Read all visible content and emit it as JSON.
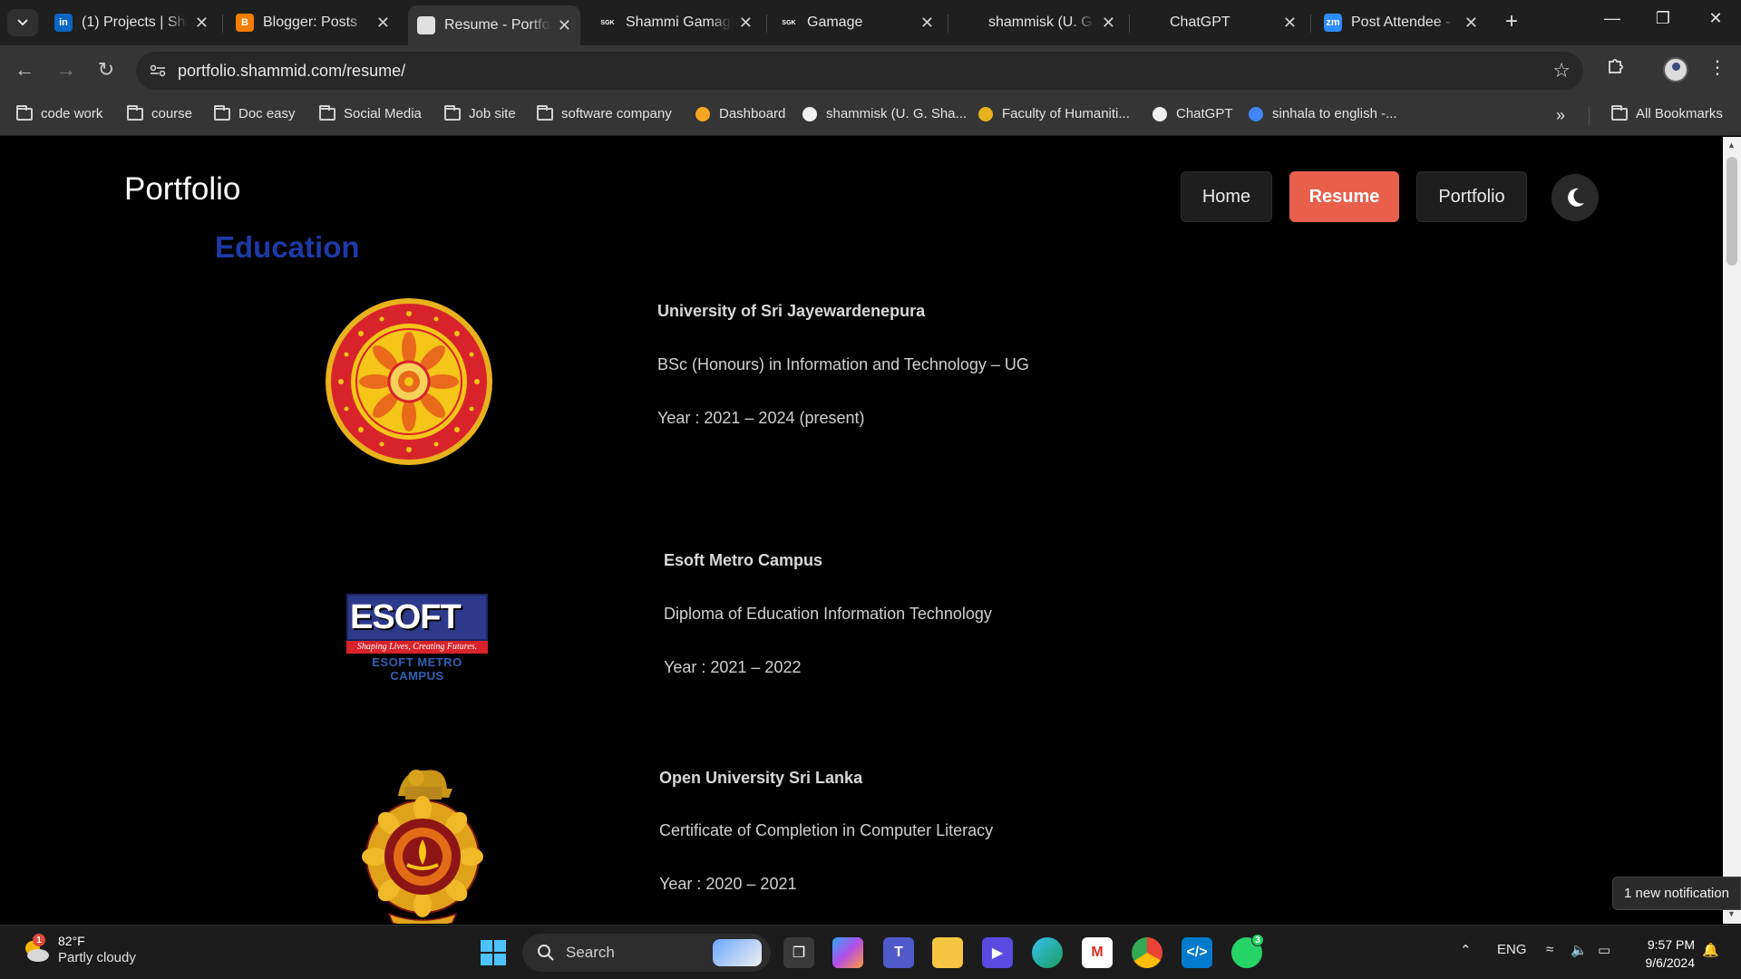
{
  "tabs": [
    {
      "title": "(1) Projects | Sha",
      "icon": "linkedin-icon",
      "color": "#0a66c2",
      "glyph": "in"
    },
    {
      "title": "Blogger: Posts",
      "icon": "blogger-icon",
      "color": "#f57d00",
      "glyph": "B"
    },
    {
      "title": "Resume - Portfol",
      "icon": "profile-favicon-icon",
      "color": "#e0e0e0",
      "glyph": "",
      "active": true
    },
    {
      "title": "Shammi Gamage",
      "icon": "sgk-favicon-icon",
      "color": "#1f1f1f",
      "glyph": "SGK"
    },
    {
      "title": "Gamage",
      "icon": "sgk-favicon-icon",
      "color": "#1f1f1f",
      "glyph": "SGK"
    },
    {
      "title": "shammisk (U. G.",
      "icon": "github-icon",
      "color": "#1f1f1f",
      "glyph": ""
    },
    {
      "title": "ChatGPT",
      "icon": "chatgpt-icon",
      "color": "#1f1f1f",
      "glyph": ""
    },
    {
      "title": "Post Attendee - ",
      "icon": "zoom-icon",
      "color": "#2d8cff",
      "glyph": "zm"
    }
  ],
  "address_bar": {
    "url": "portfolio.shammid.com/resume/"
  },
  "bookmarks": [
    {
      "label": "code work",
      "type": "folder"
    },
    {
      "label": "course",
      "type": "folder"
    },
    {
      "label": "Doc easy",
      "type": "folder"
    },
    {
      "label": "Social Media",
      "type": "folder"
    },
    {
      "label": "Job site",
      "type": "folder"
    },
    {
      "label": "software company",
      "type": "folder"
    },
    {
      "label": "Dashboard",
      "type": "link",
      "icon": "dashboard-icon"
    },
    {
      "label": "shammisk (U. G. Sha...",
      "type": "link",
      "icon": "github-icon"
    },
    {
      "label": "Faculty of Humaniti...",
      "type": "link",
      "icon": "university-favicon-icon"
    },
    {
      "label": "ChatGPT",
      "type": "link",
      "icon": "chatgpt-icon"
    },
    {
      "label": "sinhala to english -...",
      "type": "link",
      "icon": "google-icon"
    }
  ],
  "all_bookmarks_label": "All Bookmarks",
  "site": {
    "brand": "Portfolio",
    "nav": [
      {
        "label": "Home",
        "active": false
      },
      {
        "label": "Resume",
        "active": true
      },
      {
        "label": "Portfolio",
        "active": false
      }
    ],
    "section_title": "Education",
    "education": [
      {
        "institution": "University of Sri Jayewardenepura",
        "qualification": "BSc (Honours) in Information and Technology – UG",
        "year": "Year : 2021 – 2024 (present)",
        "logo": "usj-logo"
      },
      {
        "institution": "Esoft Metro Campus",
        "qualification": "Diploma of Education Information Technology",
        "year": "Year : 2021 – 2022",
        "logo": "esoft-logo",
        "logo_text": {
          "main": "ESOFT",
          "tagline": "Shaping Lives, Creating Futures.",
          "sub": "ESOFT METRO CAMPUS"
        }
      },
      {
        "institution": "Open University Sri Lanka",
        "qualification": "Certificate of Completion in Computer Literacy",
        "year": "Year : 2020 – 2021",
        "logo": "ousl-logo"
      }
    ]
  },
  "notification": "1 new notification",
  "taskbar": {
    "weather_temp": "82°F",
    "weather_cond": "Partly cloudy",
    "weather_badge": "1",
    "search_label": "Search",
    "whatsapp_badge": "3",
    "lang": "ENG",
    "time": "9:57 PM",
    "date": "9/6/2024"
  },
  "colors": {
    "accent": "#e8604c",
    "section_title": "#1d3aa8",
    "background": "#000000"
  }
}
